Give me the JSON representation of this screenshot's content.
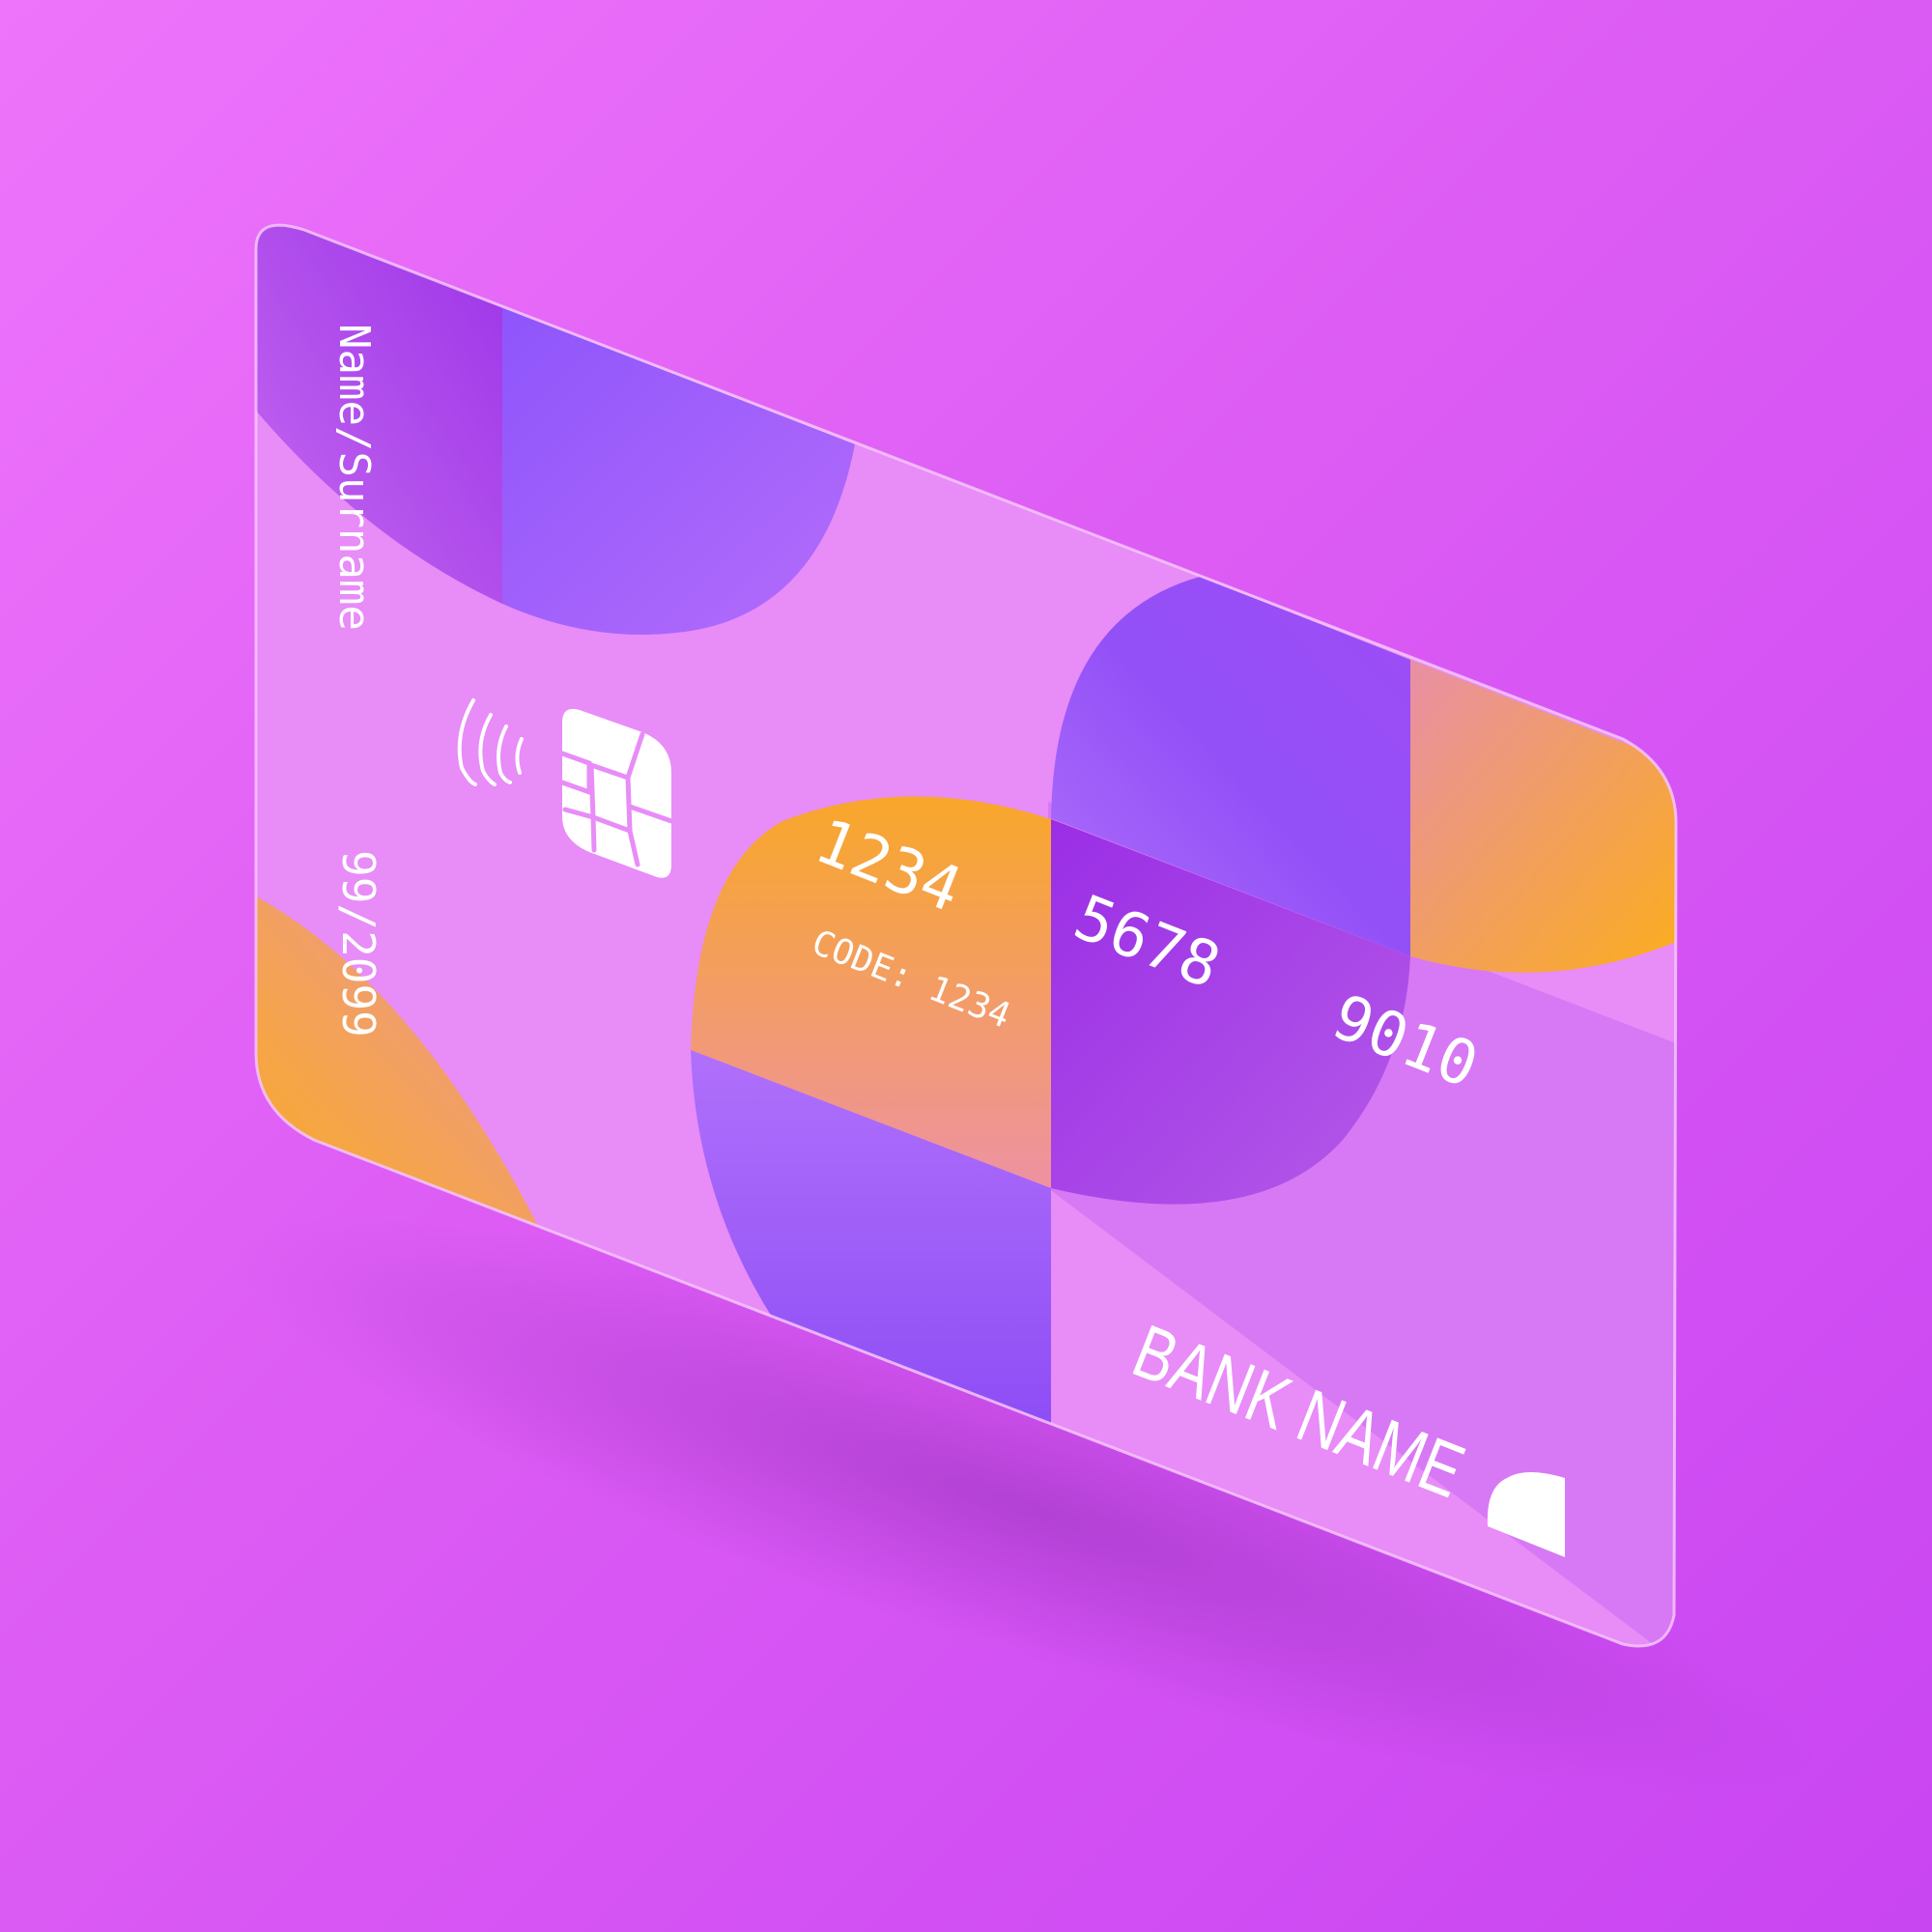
{
  "card": {
    "holder_name": "Name/Surname",
    "expiry": "99/2099",
    "number_groups": [
      "1234",
      "5678",
      "9010"
    ],
    "code_line": "CODE: 1234",
    "bank_name": "BANK NAME"
  },
  "icons": {
    "contactless": "contactless-icon",
    "chip": "chip-icon",
    "brand_logo": "logo-mark-icon"
  },
  "colors": {
    "background": "#e066f6",
    "card_base": "#e88cf8",
    "purple": "#9350f7",
    "violet_dark": "#9a2ee6",
    "orange": "#f8a83a",
    "text": "#ffffff"
  }
}
